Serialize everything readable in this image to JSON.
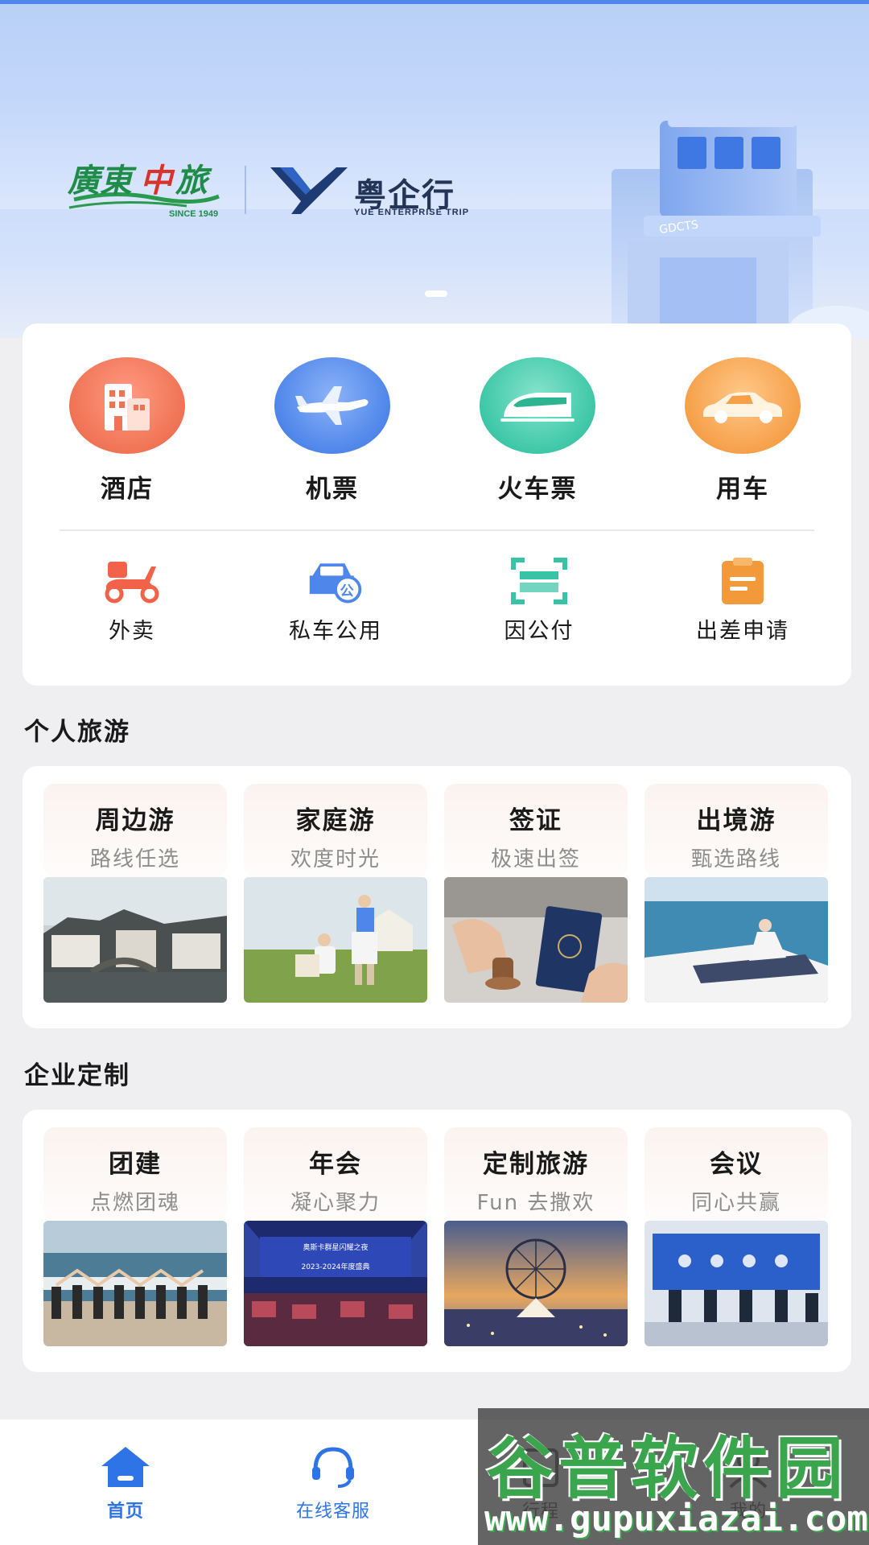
{
  "banner": {
    "logo_gdcts_text": "廣東中旅",
    "logo_gdcts_since": "SINCE 1949",
    "logo_yue_name": "粤企行",
    "logo_yue_sub": "YUE ENTERPRISE TRIP",
    "building_sign": "GDCTS"
  },
  "services": {
    "main": [
      {
        "label": "酒店",
        "icon": "hotel-icon",
        "color": "#f07355"
      },
      {
        "label": "机票",
        "icon": "airplane-icon",
        "color": "#4f86ea"
      },
      {
        "label": "火车票",
        "icon": "train-icon",
        "color": "#3ec7a7"
      },
      {
        "label": "用车",
        "icon": "car-icon",
        "color": "#f6a04a"
      }
    ],
    "secondary": [
      {
        "label": "外卖",
        "icon": "scooter-icon"
      },
      {
        "label": "私车公用",
        "icon": "private-car-icon"
      },
      {
        "label": "因公付",
        "icon": "scan-pay-icon"
      },
      {
        "label": "出差申请",
        "icon": "clipboard-icon"
      }
    ]
  },
  "personal": {
    "title": "个人旅游",
    "tiles": [
      {
        "title": "周边游",
        "subtitle": "路线任选",
        "image": "water-town-photo"
      },
      {
        "title": "家庭游",
        "subtitle": "欢度时光",
        "image": "family-photo"
      },
      {
        "title": "签证",
        "subtitle": "极速出签",
        "image": "visa-stamp-photo"
      },
      {
        "title": "出境游",
        "subtitle": "甄选路线",
        "image": "yacht-photo"
      }
    ]
  },
  "enterprise": {
    "title": "企业定制",
    "tiles": [
      {
        "title": "团建",
        "subtitle": "点燃团魂",
        "image": "beach-team-photo"
      },
      {
        "title": "年会",
        "subtitle": "凝心聚力",
        "image": "annual-meeting-photo",
        "stage_text_1": "奥斯卡群星闪耀之夜",
        "stage_text_2": "2023-2024年度盛典"
      },
      {
        "title": "定制旅游",
        "subtitle": "Fun 去撒欢",
        "image": "ferris-wheel-photo"
      },
      {
        "title": "会议",
        "subtitle": "同心共赢",
        "image": "conference-photo"
      }
    ]
  },
  "nav": {
    "items": [
      {
        "label": "首页",
        "icon": "home-icon",
        "active": true
      },
      {
        "label": "在线客服",
        "icon": "headset-icon",
        "active": false
      },
      {
        "label": "行程",
        "icon": "itinerary-icon",
        "active": false
      },
      {
        "label": "我的",
        "icon": "profile-icon",
        "active": false
      }
    ],
    "active_color": "#2f74e6",
    "inactive_color": "#2f74e6"
  },
  "watermark": {
    "name": "谷普软件园",
    "url": "www.gupuxiazai.com"
  }
}
